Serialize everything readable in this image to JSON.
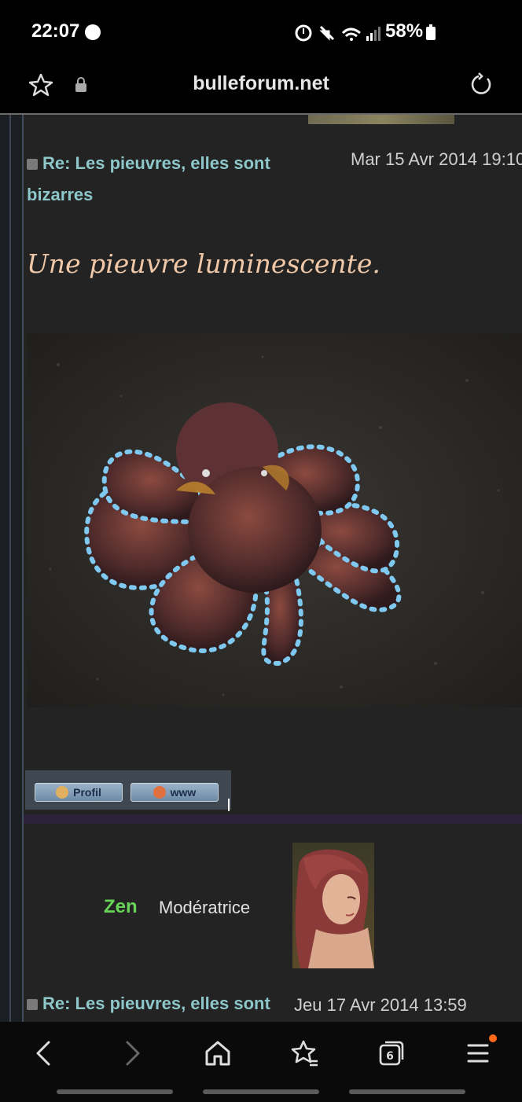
{
  "status_bar": {
    "time": "22:07",
    "icons": "⏰ 🔇 📶",
    "battery": "58%"
  },
  "browser": {
    "url": "bulleforum.net"
  },
  "post": {
    "title": "Re: Les pieuvres, elles sont bizarres",
    "date": "Mar 15 Avr 2014 19:10",
    "heading": "Une pieuvre luminescente.",
    "buttons": {
      "profil": "Profil",
      "www": "www"
    }
  },
  "next_post": {
    "author": "Zen",
    "rank": "Modératrice",
    "title": "Re: Les pieuvres, elles sont",
    "date": "Jeu 17 Avr 2014 13:59"
  },
  "colors": {
    "accent_link": "#8ec7c9",
    "heading": "#f0c8a8",
    "author": "#67d357",
    "menu_notification": "#ff6a1a"
  },
  "icons": {
    "nav": [
      "back-icon",
      "forward-icon",
      "home-icon",
      "bookmarks-icon",
      "tabs-icon",
      "menu-icon"
    ],
    "tabs_count": "6"
  }
}
